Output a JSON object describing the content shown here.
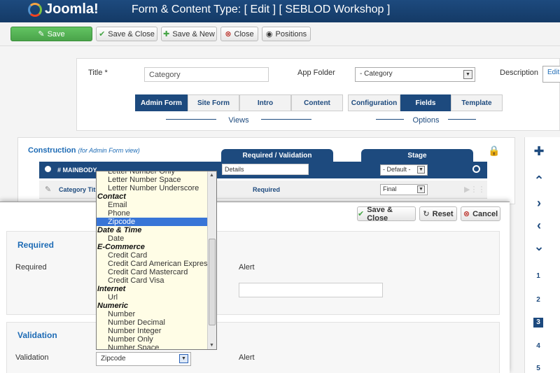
{
  "header": {
    "logo_text": "Joomla!",
    "title": "Form & Content Type: [ Edit ] [ SEBLOD Workshop ]"
  },
  "toolbar": {
    "save": "Save",
    "save_close": "Save & Close",
    "save_new": "Save & New",
    "close": "Close",
    "positions": "Positions"
  },
  "form": {
    "title_label": "Title",
    "title_required_mark": "*",
    "title_value": "Category",
    "app_folder_label": "App Folder",
    "app_folder_value": "- Category",
    "description_label": "Description",
    "description_link": "Edit",
    "view_tabs": [
      "Admin Form",
      "Site Form",
      "Intro",
      "Content"
    ],
    "views_label": "Views",
    "option_tabs": [
      "Configuration",
      "Fields",
      "Template"
    ],
    "options_label": "Options"
  },
  "construction": {
    "title": "Construction",
    "subtitle": "(for Admin Form view)",
    "col_required": "Required / Validation",
    "col_stage": "Stage",
    "mainbody_label": "# MAINBODY",
    "details_value": "Details",
    "default_value": "- Default -",
    "row_field": "Category Titl",
    "row_required": "Required",
    "row_stage": "Final"
  },
  "modal": {
    "save_close": "Save & Close",
    "reset": "Reset",
    "cancel": "Cancel",
    "required_section": "Required",
    "required_label": "Required",
    "alert_label": "Alert",
    "validation_section": "Validation",
    "validation_label": "Validation",
    "validation_value": "Zipcode",
    "alert_label_2": "Alert"
  },
  "dropdown": {
    "items": [
      {
        "type": "item",
        "text": "Letter Number Only"
      },
      {
        "type": "item",
        "text": "Letter Number Space"
      },
      {
        "type": "item",
        "text": "Letter Number Underscore"
      },
      {
        "type": "group",
        "text": "Contact"
      },
      {
        "type": "item",
        "text": "Email"
      },
      {
        "type": "item",
        "text": "Phone"
      },
      {
        "type": "item",
        "text": "Zipcode",
        "selected": true
      },
      {
        "type": "group",
        "text": "Date & Time"
      },
      {
        "type": "item",
        "text": "Date"
      },
      {
        "type": "group",
        "text": "E-Commerce"
      },
      {
        "type": "item",
        "text": "Credit Card"
      },
      {
        "type": "item",
        "text": "Credit Card American Express"
      },
      {
        "type": "item",
        "text": "Credit Card Mastercard"
      },
      {
        "type": "item",
        "text": "Credit Card Visa"
      },
      {
        "type": "group",
        "text": "Internet"
      },
      {
        "type": "item",
        "text": "Url"
      },
      {
        "type": "group",
        "text": "Numeric"
      },
      {
        "type": "item",
        "text": "Number"
      },
      {
        "type": "item",
        "text": "Number Decimal"
      },
      {
        "type": "item",
        "text": "Number Integer"
      },
      {
        "type": "item",
        "text": "Number Only"
      },
      {
        "type": "item",
        "text": "Number Space"
      }
    ]
  },
  "sidebar": {
    "icons": [
      "plus-icon",
      "arrow-up-icon",
      "arrow-right-icon",
      "arrow-left-icon",
      "arrow-down-icon"
    ],
    "numbers": [
      "1",
      "2",
      "3",
      "4",
      "5"
    ],
    "active_number": "3"
  },
  "colors": {
    "brand": "#1d4a7e",
    "accent": "#1d6bb5",
    "save_green": "#4aa34a",
    "highlight": "#3875d7"
  }
}
